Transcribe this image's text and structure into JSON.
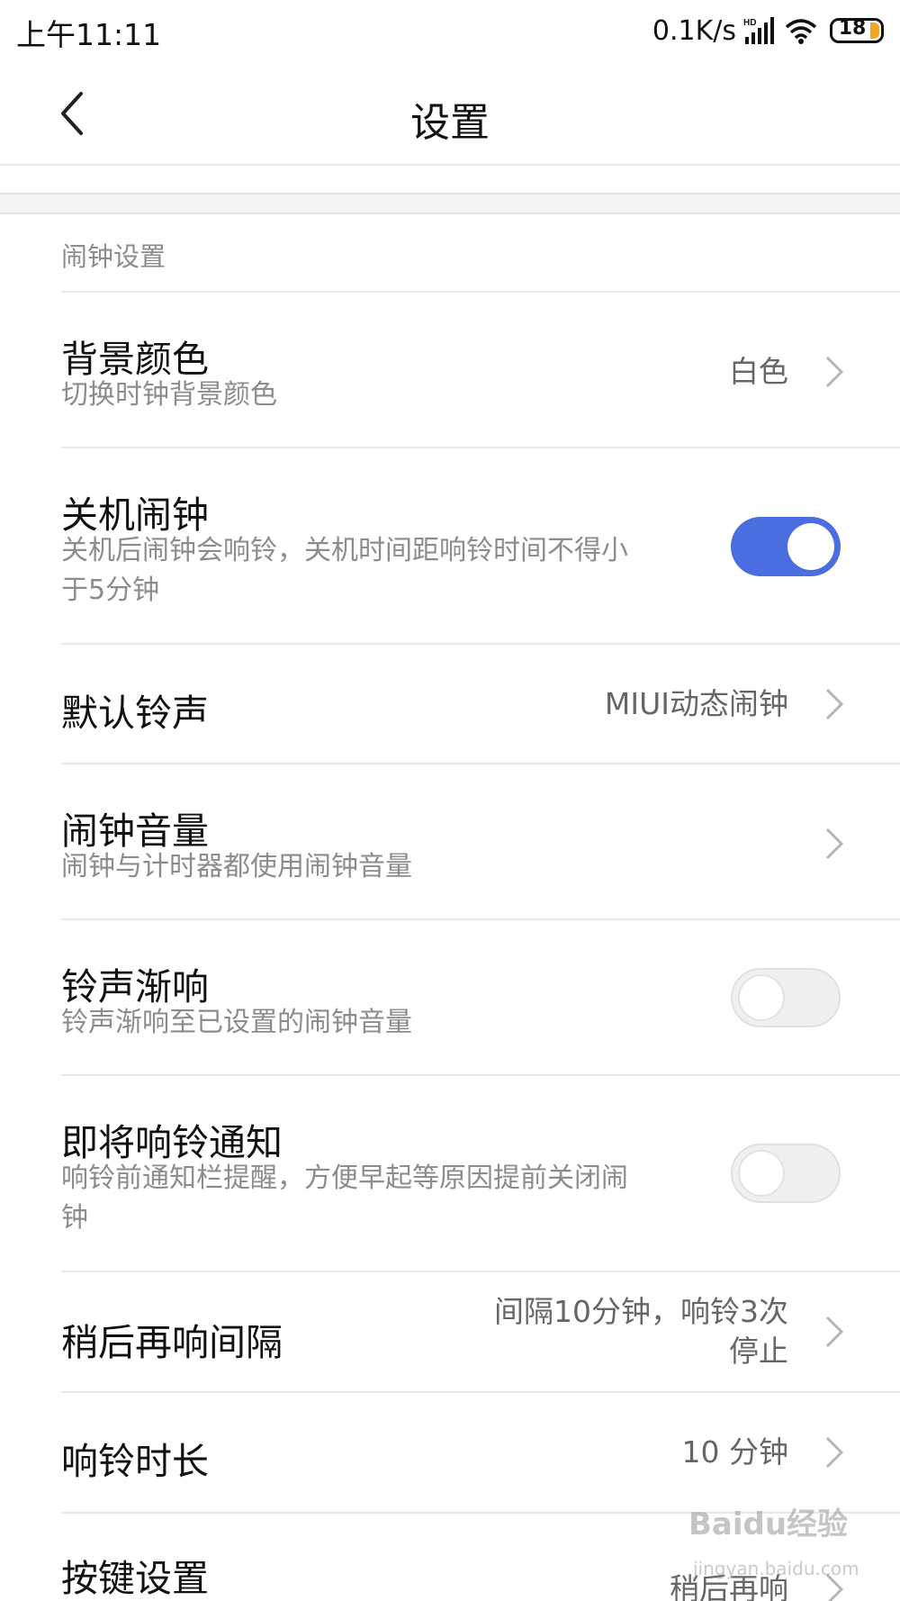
{
  "status_bar": {
    "time": "上午11:11",
    "net_speed": "0.1K/s",
    "battery_level": "18",
    "icons": [
      "hd-signal-icon",
      "wifi-icon",
      "battery-icon"
    ]
  },
  "header": {
    "title": "设置",
    "back_icon": "chevron-left-icon"
  },
  "section": {
    "label": "闹钟设置"
  },
  "settings": {
    "background_color": {
      "title": "背景颜色",
      "subtitle": "切换时钟背景颜色",
      "value": "白色"
    },
    "power_off_alarm": {
      "title": "关机闹钟",
      "subtitle_line1": "关机后闹钟会响铃，关机时间距响铃时间不得小",
      "subtitle_line2": "于5分钟",
      "enabled": true
    },
    "default_ringtone": {
      "title": "默认铃声",
      "value": "MIUI动态闹钟"
    },
    "alarm_volume": {
      "title": "闹钟音量",
      "subtitle": "闹钟与计时器都使用闹钟音量"
    },
    "gradual_ring": {
      "title": "铃声渐响",
      "subtitle": "铃声渐响至已设置的闹钟音量",
      "enabled": false
    },
    "upcoming_notification": {
      "title": "即将响铃通知",
      "subtitle_line1": "响铃前通知栏提醒，方便早起等原因提前关闭闹",
      "subtitle_line2": "钟",
      "enabled": false
    },
    "snooze_interval": {
      "title": "稍后再响间隔",
      "value_line1": "间隔10分钟，响铃3次",
      "value_line2": "停止"
    },
    "ring_duration": {
      "title": "响铃时长",
      "value": "10 分钟"
    },
    "button_settings": {
      "title": "按键设置",
      "value": "稍后再响"
    }
  },
  "watermark": {
    "text": "Baidu经验",
    "sub": "jingyan.baidu.com"
  },
  "colors": {
    "toggle_on": "#4a6ee0",
    "toggle_off": "#f0f0f0",
    "battery_accent": "#f3a620"
  }
}
